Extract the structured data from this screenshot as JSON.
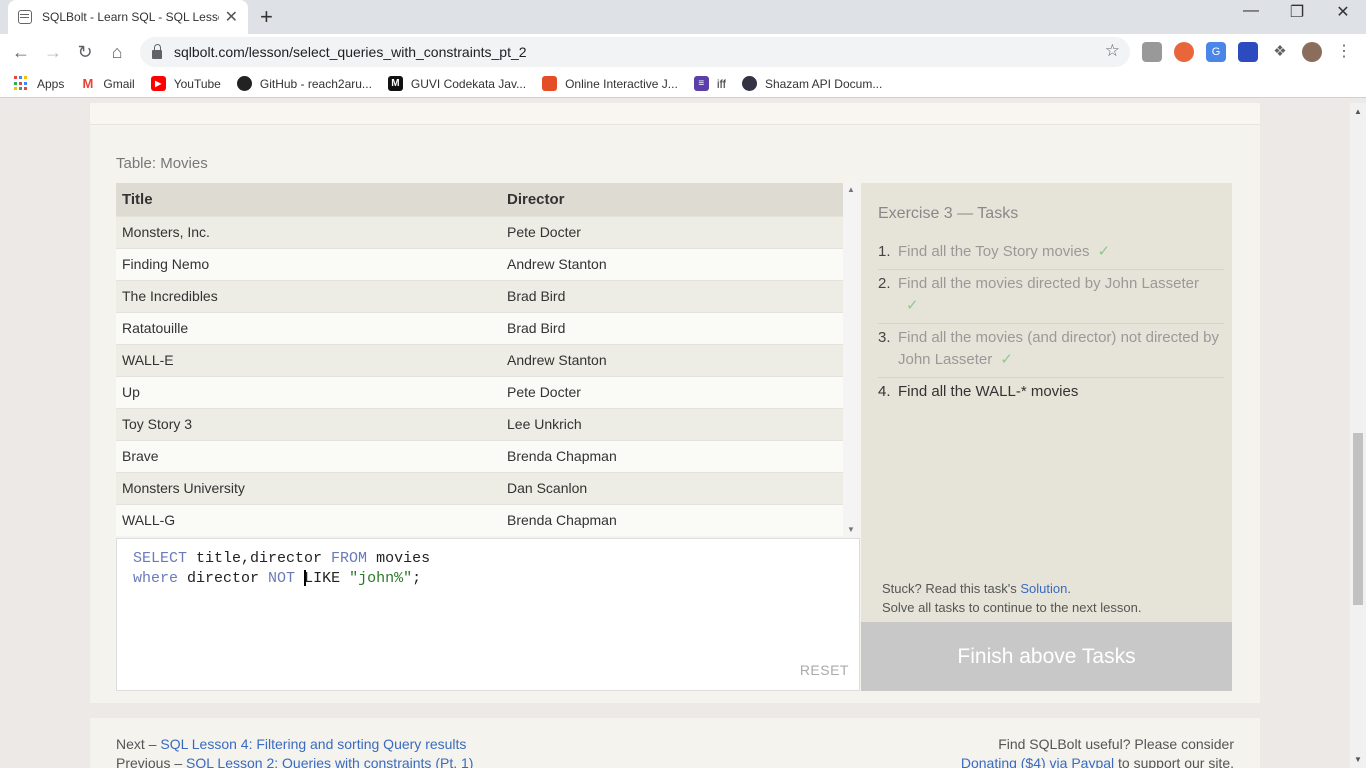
{
  "browser": {
    "tab_title": "SQLBolt - Learn SQL - SQL Lesso",
    "tab_close": "✕",
    "new_tab": "+",
    "url": "sqlbolt.com/lesson/select_queries_with_constraints_pt_2",
    "bookmarks": [
      {
        "label": "Apps",
        "icon": "apps-grid-icon"
      },
      {
        "label": "Gmail",
        "icon": "gmail-icon"
      },
      {
        "label": "YouTube",
        "icon": "youtube-icon"
      },
      {
        "label": "GitHub - reach2aru...",
        "icon": "github-icon"
      },
      {
        "label": "GUVI Codekata Jav...",
        "icon": "guvi-icon"
      },
      {
        "label": "Online Interactive J...",
        "icon": "html5-icon"
      },
      {
        "label": "iff",
        "icon": "iff-icon"
      },
      {
        "label": "Shazam API Docum...",
        "icon": "shazam-icon"
      }
    ]
  },
  "lesson": {
    "table_caption": "Table: Movies",
    "table": {
      "headers": [
        "Title",
        "Director"
      ],
      "rows": [
        [
          "Monsters, Inc.",
          "Pete Docter"
        ],
        [
          "Finding Nemo",
          "Andrew Stanton"
        ],
        [
          "The Incredibles",
          "Brad Bird"
        ],
        [
          "Ratatouille",
          "Brad Bird"
        ],
        [
          "WALL-E",
          "Andrew Stanton"
        ],
        [
          "Up",
          "Pete Docter"
        ],
        [
          "Toy Story 3",
          "Lee Unkrich"
        ],
        [
          "Brave",
          "Brenda Chapman"
        ],
        [
          "Monsters University",
          "Dan Scanlon"
        ],
        [
          "WALL-G",
          "Brenda Chapman"
        ]
      ]
    },
    "editor": {
      "line1": {
        "kw1": "SELECT",
        "t1": " title,director ",
        "kw2": "FROM",
        "t2": " movies"
      },
      "line2": {
        "kw1": "where",
        "t1": " director ",
        "kw2": "NOT",
        "t2": " ",
        "t3": "LIKE ",
        "str": "\"john%\"",
        "t4": ";"
      },
      "reset_label": "RESET"
    },
    "tasks": {
      "title": "Exercise 3 — Tasks",
      "items": [
        {
          "num": "1.",
          "text": "Find all the Toy Story movies",
          "done": "✓"
        },
        {
          "num": "2.",
          "text": "Find all the movies directed by John Lasseter",
          "done": "✓"
        },
        {
          "num": "3.",
          "text": "Find all the movies (and director) not directed by John Lasseter",
          "done": "✓"
        },
        {
          "num": "4.",
          "text": "Find all the WALL-* movies",
          "done": ""
        }
      ],
      "stuck_prefix": "Stuck? Read this task's ",
      "solution_link": "Solution",
      "stuck_suffix": ".",
      "solve_note": "Solve all tasks to continue to the next lesson.",
      "finish_label": "Finish above Tasks"
    },
    "footer": {
      "next_prefix": "Next – ",
      "next_link": "SQL Lesson 4: Filtering and sorting Query results",
      "prev_prefix": "Previous – ",
      "prev_link": "SQL Lesson 2: Queries with constraints (Pt. 1)",
      "support_text": "Find SQLBolt useful? Please consider",
      "donate_link": "Donating ($4) via Paypal",
      "donate_suffix": " to support our site."
    }
  }
}
